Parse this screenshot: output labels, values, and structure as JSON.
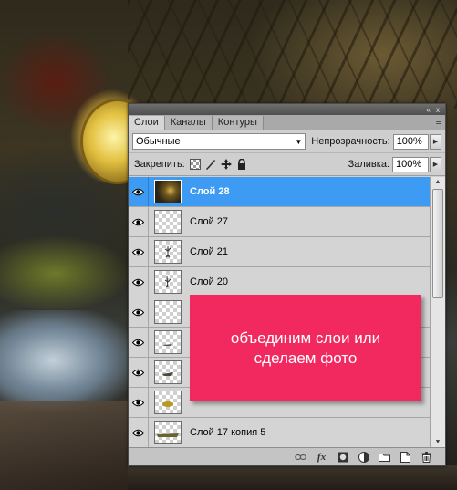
{
  "panel": {
    "titlebar": {
      "collapse_icon": "«",
      "close_icon": "x"
    },
    "tabs": [
      {
        "label": "Слои",
        "active": true
      },
      {
        "label": "Каналы",
        "active": false
      },
      {
        "label": "Контуры",
        "active": false
      }
    ],
    "menu_icon": "≡",
    "blend_mode": "Обычные",
    "opacity_label": "Непрозрачность:",
    "opacity_value": "100%",
    "lock_label": "Закрепить:",
    "fill_label": "Заливка:",
    "fill_value": "100%",
    "layers": [
      {
        "name": "Слой 28",
        "selected": true,
        "thumb": "photo"
      },
      {
        "name": "Слой 27",
        "selected": false,
        "thumb": "empty"
      },
      {
        "name": "Слой 21",
        "selected": false,
        "thumb": "figure"
      },
      {
        "name": "Слой 20",
        "selected": false,
        "thumb": "figure"
      },
      {
        "name": "",
        "selected": false,
        "thumb": "empty"
      },
      {
        "name": "",
        "selected": false,
        "thumb": "object"
      },
      {
        "name": "",
        "selected": false,
        "thumb": "object"
      },
      {
        "name": "",
        "selected": false,
        "thumb": "yellow"
      },
      {
        "name": "Слой 17 копия 5",
        "selected": false,
        "thumb": "book"
      }
    ],
    "bottom_icons": [
      "link-icon",
      "fx-icon",
      "mask-icon",
      "adjustment-icon",
      "folder-icon",
      "new-layer-icon",
      "trash-icon"
    ],
    "fx_label": "fx"
  },
  "note": {
    "text": "объединим слои или сделаем фото",
    "color": "#f2295e"
  },
  "colors": {
    "selection": "#3d9bf3",
    "panel_bg": "#cfcfcf"
  }
}
